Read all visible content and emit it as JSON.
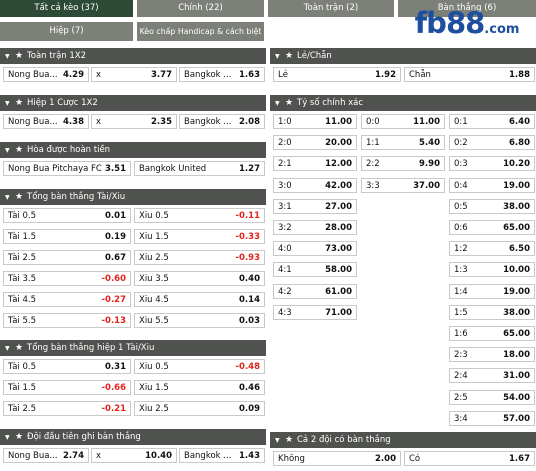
{
  "tabs": [
    {
      "label": "Tất cả kèo (37)"
    },
    {
      "label": "Chính (22)"
    },
    {
      "label": "Toàn trận (2)"
    },
    {
      "label": "Bàn thắng (6)"
    },
    {
      "label": "Hiệp (7)"
    },
    {
      "label": "Kèo chấp Handicap & cách biệt (1)"
    }
  ],
  "brand": {
    "logo_main": "fb88",
    "logo_suffix": ".com"
  },
  "colors": {
    "active_tab": "#2d4a37",
    "tab": "#7c8078",
    "header": "#4f524e",
    "negative": "#e0241c"
  },
  "s1x2": {
    "title": "Toàn trận 1X2",
    "home": "Nong Bua...",
    "home_odds": "4.29",
    "draw": "x",
    "draw_odds": "3.77",
    "away": "Bangkok ...",
    "away_odds": "1.63"
  },
  "h1x2": {
    "title": "Hiệp 1 Cược 1X2",
    "home": "Nong Bua...",
    "home_odds": "4.38",
    "draw": "x",
    "draw_odds": "2.35",
    "away": "Bangkok ...",
    "away_odds": "2.08"
  },
  "dnb": {
    "title": "Hòa được hoàn tiền",
    "home": "Nong Bua Pitchaya FC",
    "home_odds": "3.51",
    "away": "Bangkok United",
    "away_odds": "1.27"
  },
  "ou": {
    "title": "Tổng bàn thắng Tài/Xiu",
    "rows": [
      {
        "over": "Tài 0.5",
        "over_odds": "0.01",
        "under": "Xiu 0.5",
        "under_odds": "-0.11"
      },
      {
        "over": "Tài 1.5",
        "over_odds": "0.19",
        "under": "Xiu 1.5",
        "under_odds": "-0.33"
      },
      {
        "over": "Tài 2.5",
        "over_odds": "0.67",
        "under": "Xiu 2.5",
        "under_odds": "-0.93"
      },
      {
        "over": "Tài 3.5",
        "over_odds": "-0.60",
        "under": "Xiu 3.5",
        "under_odds": "0.40"
      },
      {
        "over": "Tài 4.5",
        "over_odds": "-0.27",
        "under": "Xiu 4.5",
        "under_odds": "0.14"
      },
      {
        "over": "Tài 5.5",
        "over_odds": "-0.13",
        "under": "Xiu 5.5",
        "under_odds": "0.03"
      }
    ]
  },
  "ouh1": {
    "title": "Tổng bàn thắng hiệp 1 Tài/Xiu",
    "rows": [
      {
        "over": "Tài 0.5",
        "over_odds": "0.31",
        "under": "Xiu 0.5",
        "under_odds": "-0.48"
      },
      {
        "over": "Tài 1.5",
        "over_odds": "-0.66",
        "under": "Xiu 1.5",
        "under_odds": "0.46"
      },
      {
        "over": "Tài 2.5",
        "over_odds": "-0.21",
        "under": "Xiu 2.5",
        "under_odds": "0.09"
      }
    ]
  },
  "first_goal": {
    "title": "Đội đầu tiên ghi bàn thắng",
    "home": "Nong Bua...",
    "home_odds": "2.74",
    "draw": "x",
    "draw_odds": "10.40",
    "away": "Bangkok ...",
    "away_odds": "1.43"
  },
  "oddeven": {
    "title": "Lẻ/Chẵn",
    "odd": "Lẻ",
    "odd_odds": "1.92",
    "even": "Chẵn",
    "even_odds": "1.88"
  },
  "cs": {
    "title": "Tỷ số chính xác",
    "home": [
      {
        "score": "1:0",
        "odds": "11.00"
      },
      {
        "score": "2:0",
        "odds": "20.00"
      },
      {
        "score": "2:1",
        "odds": "12.00"
      },
      {
        "score": "3:0",
        "odds": "42.00"
      },
      {
        "score": "3:1",
        "odds": "27.00"
      },
      {
        "score": "3:2",
        "odds": "28.00"
      },
      {
        "score": "4:0",
        "odds": "73.00"
      },
      {
        "score": "4:1",
        "odds": "58.00"
      },
      {
        "score": "4:2",
        "odds": "61.00"
      },
      {
        "score": "4:3",
        "odds": "71.00"
      }
    ],
    "draw": [
      {
        "score": "0:0",
        "odds": "11.00"
      },
      {
        "score": "1:1",
        "odds": "5.40"
      },
      {
        "score": "2:2",
        "odds": "9.90"
      },
      {
        "score": "3:3",
        "odds": "37.00"
      }
    ],
    "away": [
      {
        "score": "0:1",
        "odds": "6.40"
      },
      {
        "score": "0:2",
        "odds": "6.80"
      },
      {
        "score": "0:3",
        "odds": "10.20"
      },
      {
        "score": "0:4",
        "odds": "19.00"
      },
      {
        "score": "0:5",
        "odds": "38.00"
      },
      {
        "score": "0:6",
        "odds": "65.00"
      },
      {
        "score": "1:2",
        "odds": "6.50"
      },
      {
        "score": "1:3",
        "odds": "10.00"
      },
      {
        "score": "1:4",
        "odds": "19.00"
      },
      {
        "score": "1:5",
        "odds": "38.00"
      },
      {
        "score": "1:6",
        "odds": "65.00"
      },
      {
        "score": "2:3",
        "odds": "18.00"
      },
      {
        "score": "2:4",
        "odds": "31.00"
      },
      {
        "score": "2:5",
        "odds": "54.00"
      },
      {
        "score": "3:4",
        "odds": "57.00"
      }
    ]
  },
  "btts": {
    "title": "Cả 2 đội có bàn thắng",
    "no": "Không",
    "no_odds": "2.00",
    "yes": "Có",
    "yes_odds": "1.67"
  }
}
